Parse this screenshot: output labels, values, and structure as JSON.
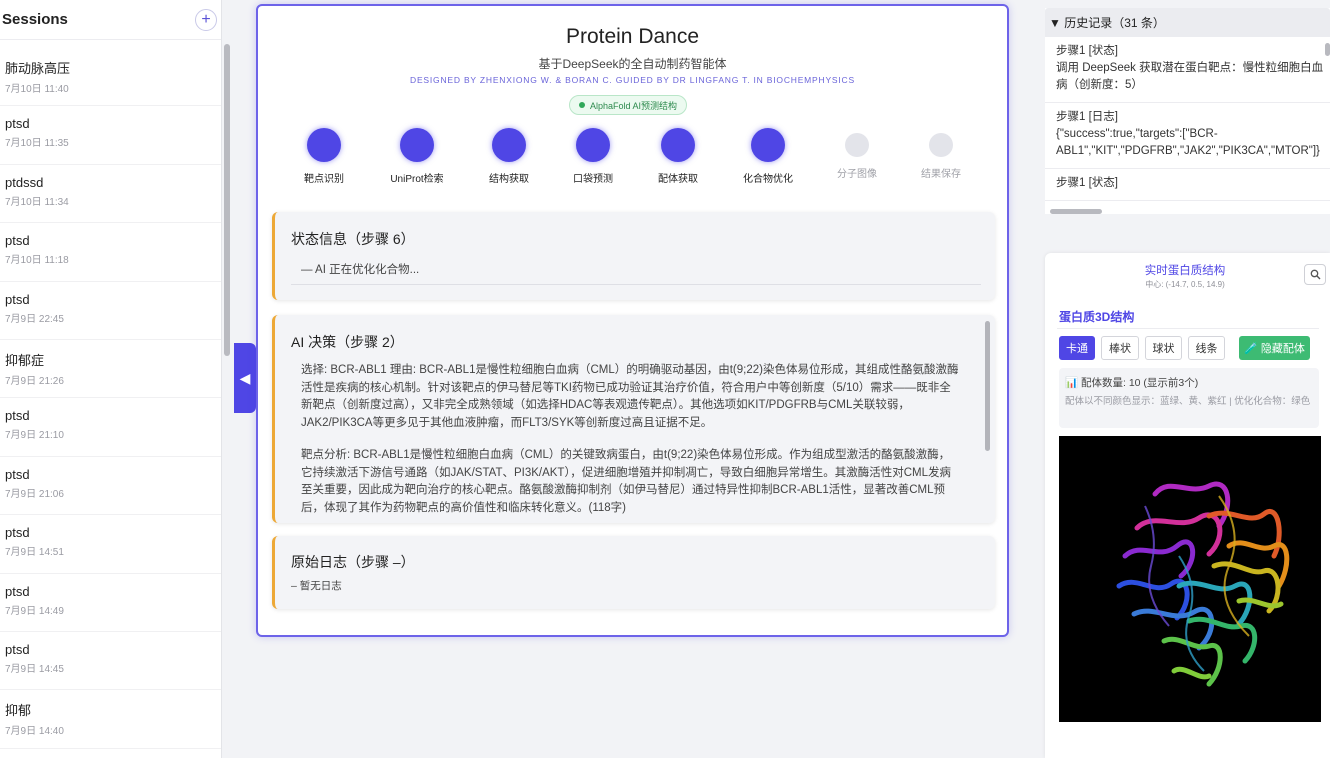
{
  "sidebar": {
    "title": "Sessions",
    "add_label": "+",
    "sessions": [
      {
        "name": "肺动脉高压",
        "time": "7月10日 11:40"
      },
      {
        "name": "ptsd",
        "time": "7月10日 11:35"
      },
      {
        "name": "ptdssd",
        "time": "7月10日 11:34"
      },
      {
        "name": "ptsd",
        "time": "7月10日 11:18"
      },
      {
        "name": "ptsd",
        "time": "7月9日 22:45"
      },
      {
        "name": "抑郁症",
        "time": "7月9日 21:26"
      },
      {
        "name": "ptsd",
        "time": "7月9日 21:10"
      },
      {
        "name": "ptsd",
        "time": "7月9日 21:06"
      },
      {
        "name": "ptsd",
        "time": "7月9日 14:51"
      },
      {
        "name": "ptsd",
        "time": "7月9日 14:49"
      },
      {
        "name": "ptsd",
        "time": "7月9日 14:45"
      },
      {
        "name": "抑郁",
        "time": "7月9日 14:40"
      }
    ],
    "collapse_icon": "chevron-left-icon"
  },
  "header": {
    "title": "Protein Dance",
    "subtitle": "基于DeepSeek的全自动制药智能体",
    "credit": "DESIGNED BY ZHENXIONG W. & BORAN C. GUIDED BY DR LINGFANG T. IN BIOCHEMPHYSICS",
    "badge": "AlphaFold AI预测结构"
  },
  "steps": [
    {
      "label": "靶点识别",
      "status": "done"
    },
    {
      "label": "UniProt检索",
      "status": "done"
    },
    {
      "label": "结构获取",
      "status": "done"
    },
    {
      "label": "口袋预测",
      "status": "done"
    },
    {
      "label": "配体获取",
      "status": "done"
    },
    {
      "label": "化合物优化",
      "status": "done"
    },
    {
      "label": "分子图像",
      "status": "pending"
    },
    {
      "label": "结果保存",
      "status": "pending"
    }
  ],
  "status_panel": {
    "title": "状态信息（步骤 6）",
    "text": "— AI 正在优化化合物..."
  },
  "ai_panel": {
    "title": "AI 决策（步骤 2）",
    "para1": "选择: BCR-ABL1 理由: BCR-ABL1是慢性粒细胞白血病（CML）的明确驱动基因，由t(9;22)染色体易位形成，其组成性酪氨酸激酶活性是疾病的核心机制。针对该靶点的伊马替尼等TKI药物已成功验证其治疗价值，符合用户中等创新度（5/10）需求——既非全新靶点（创新度过高），又非完全成熟领域（如选择HDAC等表观遗传靶点）。其他选项如KIT/PDGFRB与CML关联较弱，JAK2/PIK3CA等更多见于其他血液肿瘤，而FLT3/SYK等创新度过高且证据不足。",
    "para2": "靶点分析: BCR-ABL1是慢性粒细胞白血病（CML）的关键致病蛋白，由t(9;22)染色体易位形成。作为组成型激活的酪氨酸激酶，它持续激活下游信号通路（如JAK/STAT、PI3K/AKT），促进细胞增殖并抑制凋亡，导致白细胞异常增生。其激酶活性对CML发病至关重要，因此成为靶向治疗的核心靶点。酪氨酸激酶抑制剂（如伊马替尼）通过特异性抑制BCR-ABL1活性，显著改善CML预后，体现了其作为药物靶点的高价值性和临床转化意义。(118字)"
  },
  "log_panel": {
    "title": "原始日志（步骤 –）",
    "text": "– 暂无日志"
  },
  "history": {
    "header": "▼ 历史记录（31 条）",
    "entries": [
      {
        "title": "步骤1 [状态]",
        "body": "调用 DeepSeek 获取潜在蛋白靶点：慢性粒细胞白血病（创新度：5）"
      },
      {
        "title": "步骤1 [日志]",
        "body": "{\"success\":true,\"targets\":[\"BCR-ABL1\",\"KIT\",\"PDGFRB\",\"JAK2\",\"PIK3CA\",\"MTOR\"]}"
      },
      {
        "title": "步骤1 [状态]",
        "body": ""
      }
    ]
  },
  "viewer": {
    "title": "实时蛋白质结构",
    "coords": "中心: (-14.7, 0.5, 14.9)",
    "search_icon": "magnifier-icon",
    "heading": "蛋白质3D结构",
    "styles": [
      "卡通",
      "棒状",
      "球状",
      "线条"
    ],
    "active_style": "卡通",
    "hide_ligand": "🧪 隐藏配体",
    "ligand_count": "📊 配体数量: 10 (显示前3个)",
    "ligand_colors": "配体以不同颜色显示：蓝绿、黄、紫红 | 优化化合物：绿色"
  },
  "colors": {
    "accent": "#4f46e5",
    "panel_border": "#eda836",
    "badge_green": "#31a85a",
    "hide_button": "#3dbb73"
  }
}
